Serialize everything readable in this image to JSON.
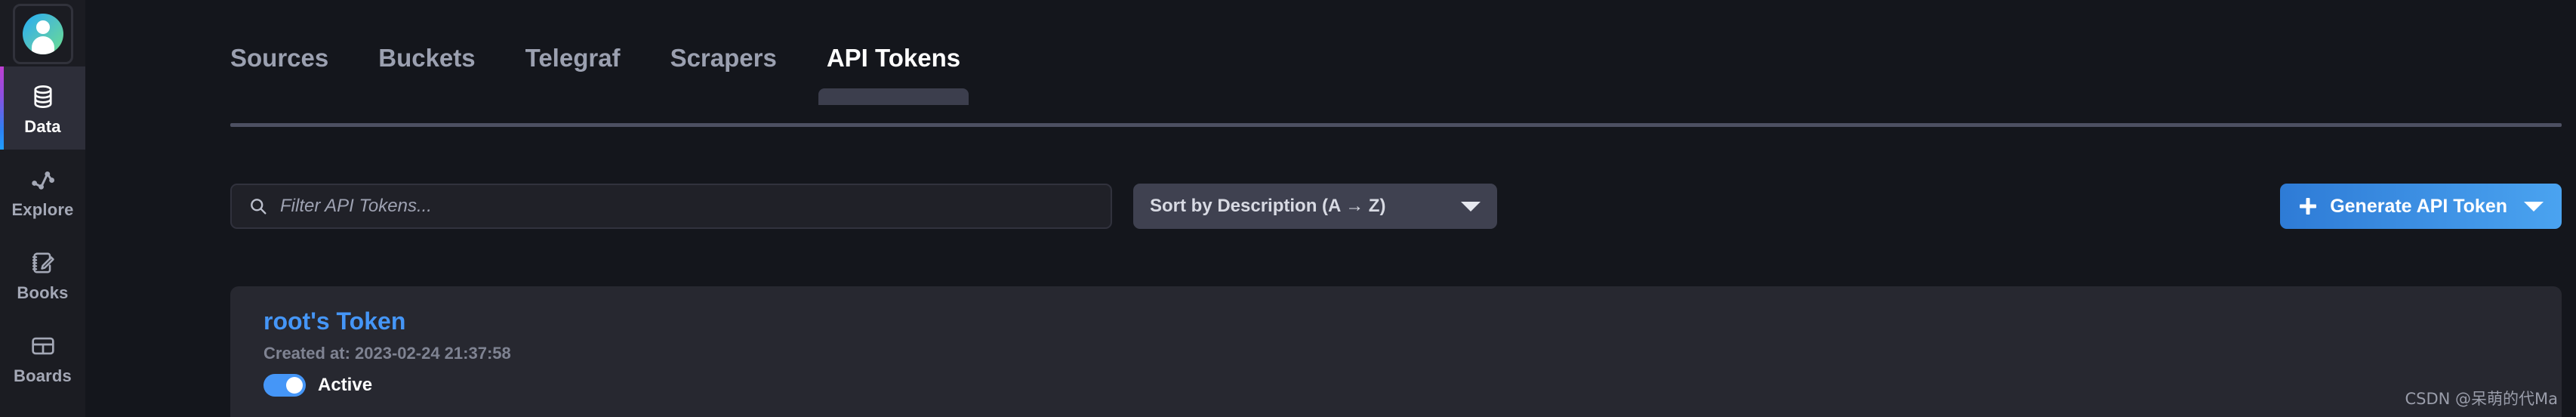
{
  "sidebar": {
    "avatar_label": "User avatar",
    "items": [
      {
        "label": "Data",
        "icon": "database-icon",
        "active": true
      },
      {
        "label": "Explore",
        "icon": "graph-line-icon",
        "active": false
      },
      {
        "label": "Books",
        "icon": "notebook-pencil-icon",
        "active": false
      },
      {
        "label": "Boards",
        "icon": "dashboard-grid-icon",
        "active": false
      }
    ]
  },
  "tabs": [
    {
      "label": "Sources",
      "active": false
    },
    {
      "label": "Buckets",
      "active": false
    },
    {
      "label": "Telegraf",
      "active": false
    },
    {
      "label": "Scrapers",
      "active": false
    },
    {
      "label": "API Tokens",
      "active": true
    }
  ],
  "toolbar": {
    "search": {
      "icon": "search-icon",
      "value": "",
      "placeholder": "Filter API Tokens..."
    },
    "sort": {
      "selected": "Sort by Description (A → Z)",
      "icon": "chevron-down-icon"
    },
    "generate_button": {
      "label": "Generate API Token",
      "plus_icon": "plus-icon",
      "caret_icon": "chevron-down-icon"
    }
  },
  "tokens": [
    {
      "name": "root's Token",
      "created": "Created at: 2023-02-24 21:37:58",
      "status": "Active",
      "enabled": true
    }
  ],
  "watermark": "CSDN @呆萌的代Ma",
  "colors": {
    "accent_blue": "#4596f7",
    "button_gradient_start": "#2e7bd6",
    "button_gradient_end": "#4aa3f0",
    "page_bg": "#14161c",
    "sidebar_bg": "#1b1c22",
    "card_bg": "#272830"
  }
}
